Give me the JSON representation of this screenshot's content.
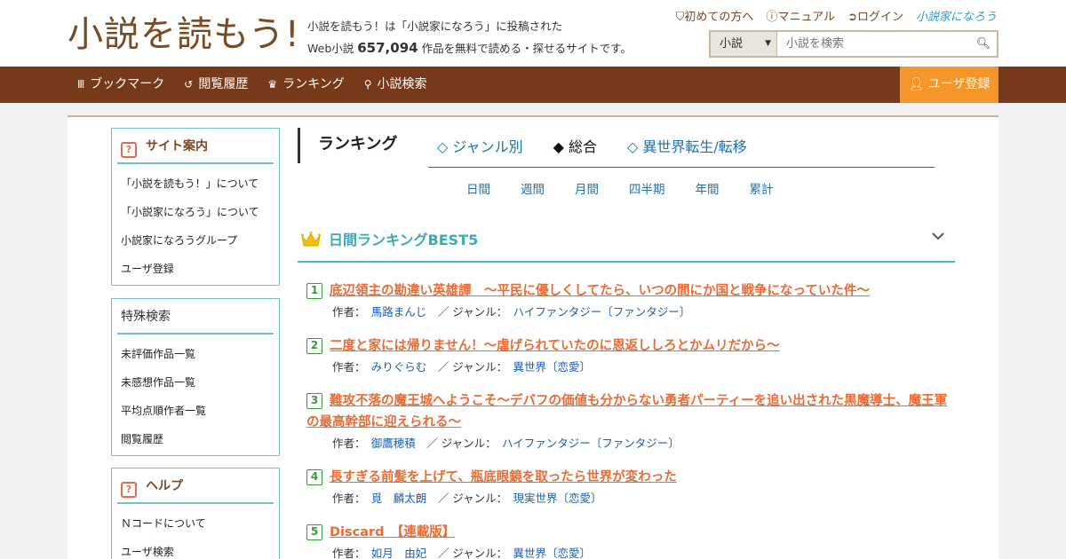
{
  "header": {
    "logo": "小説を読もう!",
    "tagline_line1": "小説を読もう！は「小説家になろう」に投稿された",
    "tagline_prefix": "Web小説",
    "work_count": "657,094",
    "tagline_suffix": "作品を無料で読める・探せるサイトです。",
    "links": [
      "初めての方へ",
      "マニュアル",
      "ログイン"
    ],
    "brand_link": "小説家になろう",
    "search": {
      "category": "小説",
      "placeholder": "小説を検索"
    }
  },
  "nav": {
    "items": [
      "ブックマーク",
      "閲覧履歴",
      "ランキング",
      "小説検索"
    ],
    "signup": "ユーザ登録"
  },
  "sidebar": {
    "guide": {
      "title": "サイト案内",
      "items": [
        "「小説を読もう！」について",
        "「小説家になろう」について",
        "小説家になろうグループ",
        "ユーザ登録"
      ]
    },
    "special": {
      "title": "特殊検索",
      "items": [
        "未評価作品一覧",
        "未感想作品一覧",
        "平均点順作者一覧",
        "閲覧履歴"
      ]
    },
    "help": {
      "title": "ヘルプ",
      "items": [
        "Ｎコードについて",
        "ユーザ検索"
      ]
    }
  },
  "ranking": {
    "title": "ランキング",
    "tabs": [
      "◇ ジャンル別",
      "◆ 総合",
      "◇ 異世界転生/転移"
    ],
    "active_tab": 1,
    "periods": [
      "日間",
      "週間",
      "月間",
      "四半期",
      "年間",
      "累計"
    ],
    "best_title": "日間ランキングBEST5",
    "author_label": "作者：",
    "genre_label": "／ ジャンル：",
    "entries": [
      {
        "num": "1",
        "title": "底辺領主の勘違い英雄譚　～平民に優しくしてたら、いつの間にか国と戦争になっていた件～",
        "author": "馬路まんじ",
        "genre": "ハイファンタジー〔ファンタジー〕"
      },
      {
        "num": "2",
        "title": "二度と家には帰りません！～虐げられていたのに恩返ししろとかムリだから～",
        "author": "みりぐらむ",
        "genre": "異世界〔恋愛〕"
      },
      {
        "num": "3",
        "title": "難攻不落の魔王城へようこそ～デバフの価値も分からない勇者パーティーを追い出された黒魔導士、魔王軍の最高幹部に迎えられる～",
        "author": "御鷹穂積",
        "genre": "ハイファンタジー〔ファンタジー〕"
      },
      {
        "num": "4",
        "title": "長すぎる前髪を上げて、瓶底眼鏡を取ったら世界が変わった",
        "author": "覓　麟太朗",
        "genre": "現実世界〔恋愛〕"
      },
      {
        "num": "5",
        "title": "Discard　【連載版】",
        "author": "如月　由妃",
        "genre": "異世界〔恋愛〕"
      }
    ]
  }
}
